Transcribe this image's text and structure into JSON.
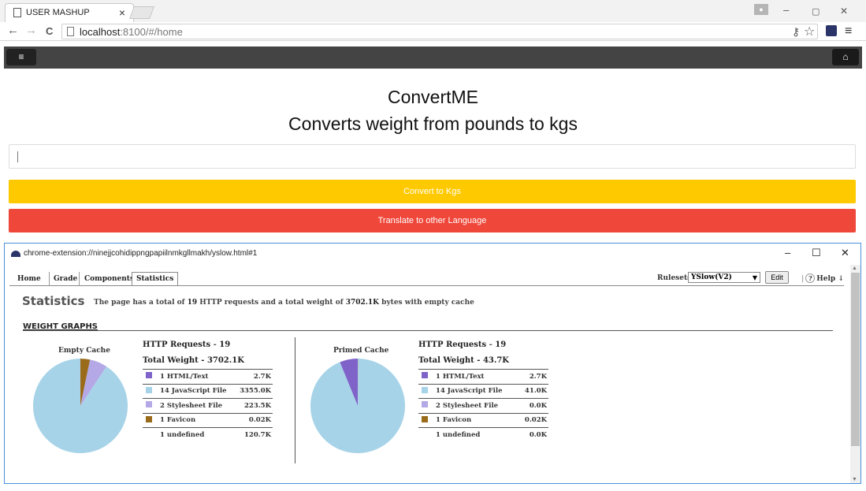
{
  "browser": {
    "tab_title": "USER MASHUP",
    "tab_close": "×",
    "url_host": "localhost",
    "url_path": ":8100/#/home",
    "back_icon": "←",
    "forward_icon": "→",
    "reload_icon": "C",
    "key_icon": "⚷",
    "star_icon": "☆",
    "menu_icon": "≡",
    "min_icon": "–",
    "max_icon": "▢",
    "close_icon": "✕"
  },
  "app": {
    "menu_icon": "≡",
    "home_icon": "⌂",
    "title": "ConvertME",
    "subtitle": "Converts weight from pounds to kgs",
    "input_value": "",
    "convert_label": "Convert to Kgs",
    "translate_label": "Translate to other Language",
    "colors": {
      "navbar": "#444444",
      "convert": "#ffc900",
      "translate": "#ef473a"
    }
  },
  "yslow": {
    "window_url": "chrome-extension://ninejjcohidippngpapiilnmkgllmakh/yslow.html#1",
    "min_icon": "–",
    "max_icon": "☐",
    "close_icon": "✕",
    "tabs": [
      "Home",
      "Grade",
      "Components",
      "Statistics"
    ],
    "active_tab": "Statistics",
    "rulesets_label": "Rulesets",
    "ruleset_value": "YSlow(V2)",
    "edit_label": "Edit",
    "help_label": "Help ↓",
    "stats_heading": "Statistics",
    "summary_pre": "The page has a total of ",
    "summary_requests": "19",
    "summary_mid": " HTTP requests and a total weight of ",
    "summary_weight": "3702.1K",
    "summary_post": " bytes with empty cache",
    "weight_graphs": "WEIGHT GRAPHS",
    "empty_cache": {
      "title": "Empty Cache",
      "http_label": "HTTP Requests",
      "http_count": "19",
      "weight_label": "Total Weight",
      "weight_value": "3702.1K",
      "rows": [
        {
          "label": "1 HTML/Text",
          "value": "2.7K",
          "color": "#7f63c9"
        },
        {
          "label": "14 JavaScript File",
          "value": "3355.0K",
          "color": "#a7d3e8"
        },
        {
          "label": "2 Stylesheet File",
          "value": "223.5K",
          "color": "#b4a9e6"
        },
        {
          "label": "1 Favicon",
          "value": "0.02K",
          "color": "#9a6b1a"
        },
        {
          "label": "1 undefined",
          "value": "120.7K",
          "color": ""
        }
      ]
    },
    "primed_cache": {
      "title": "Primed Cache",
      "http_label": "HTTP Requests",
      "http_count": "19",
      "weight_label": "Total Weight",
      "weight_value": "43.7K",
      "rows": [
        {
          "label": "1 HTML/Text",
          "value": "2.7K",
          "color": "#7f63c9"
        },
        {
          "label": "14 JavaScript File",
          "value": "41.0K",
          "color": "#a7d3e8"
        },
        {
          "label": "2 Stylesheet File",
          "value": "0.0K",
          "color": "#b4a9e6"
        },
        {
          "label": "1 Favicon",
          "value": "0.02K",
          "color": "#9a6b1a"
        },
        {
          "label": "1 undefined",
          "value": "0.0K",
          "color": ""
        }
      ]
    }
  },
  "chart_data": [
    {
      "type": "pie",
      "title": "Empty Cache",
      "categories": [
        "HTML/Text",
        "JavaScript File",
        "Stylesheet File",
        "Favicon",
        "undefined"
      ],
      "values": [
        2.7,
        3355.0,
        223.5,
        0.02,
        120.7
      ],
      "colors": [
        "#7f63c9",
        "#a7d3e8",
        "#b4a9e6",
        "#9a6b1a",
        "#9a6b1a"
      ]
    },
    {
      "type": "pie",
      "title": "Primed Cache",
      "categories": [
        "HTML/Text",
        "JavaScript File",
        "Stylesheet File",
        "Favicon",
        "undefined"
      ],
      "values": [
        2.7,
        41.0,
        0.0,
        0.02,
        0.0
      ],
      "colors": [
        "#7f63c9",
        "#a7d3e8",
        "#b4a9e6",
        "#9a6b1a",
        "#9a6b1a"
      ]
    }
  ]
}
